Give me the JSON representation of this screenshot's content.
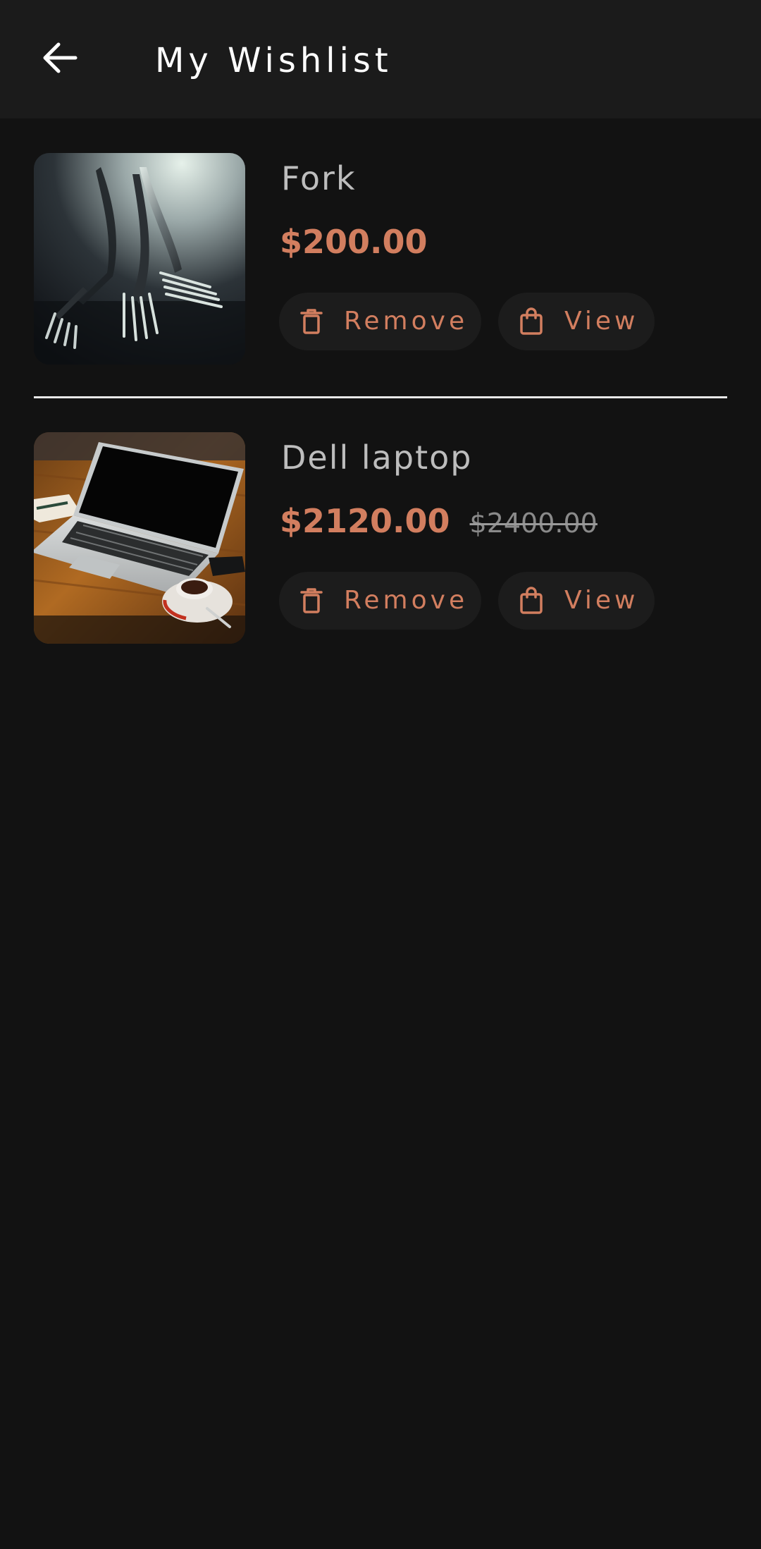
{
  "header": {
    "title": "My Wishlist",
    "back_icon": "arrow-left-icon"
  },
  "items": [
    {
      "name": "Fork",
      "price": "$200.00",
      "original_price": "",
      "image": "forks-photo",
      "remove_label": "Remove",
      "view_label": "View"
    },
    {
      "name": "Dell laptop",
      "price": "$2120.00",
      "original_price": "$2400.00",
      "image": "laptop-photo",
      "remove_label": "Remove",
      "view_label": "View"
    }
  ],
  "colors": {
    "background": "#121212",
    "app_bar": "#1b1b1b",
    "accent": "#d27e5f",
    "button_bg": "#1c1c1c",
    "name_text": "#bdbdbd",
    "strike_text": "#8a8a8a"
  },
  "icons": {
    "remove": "trash-icon",
    "view": "shopping-bag-icon"
  }
}
